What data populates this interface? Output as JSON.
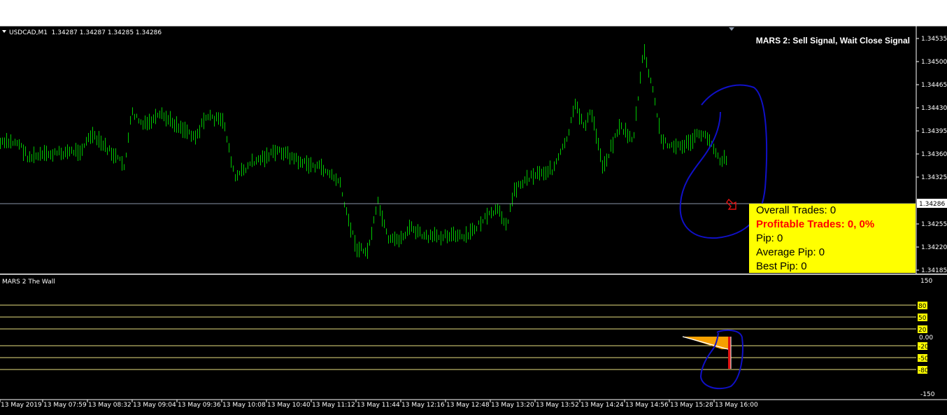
{
  "main": {
    "symbol_info": "USDCAD,M1  1.34287 1.34287 1.34285 1.34286",
    "signal": "MARS 2: Sell Signal, Wait Close Signal",
    "price_ticks": [
      "1.34535",
      "1.34500",
      "1.34465",
      "1.34430",
      "1.34395",
      "1.34360",
      "1.34325",
      "1.34255",
      "1.34220",
      "1.34185"
    ],
    "current_price": "1.34286",
    "price_range": [
      1.3417,
      1.3454
    ],
    "colors": {
      "candle": "#00c800",
      "background": "#000000",
      "annotation": "#1010c8",
      "stats_bg": "#ffff00",
      "label_bg": "#ffff00"
    }
  },
  "stats": {
    "overall": "Overall Trades: 0",
    "profitable": "Profitable Trades: 0, 0%",
    "pip": "Pip: 0",
    "average": "Average Pip: 0",
    "best": "Best Pip: 0"
  },
  "indicator": {
    "title": "MARS 2 The Wall",
    "top_tick": "150",
    "bottom_tick": "-150",
    "zero_tick": "0.00",
    "levels": [
      "80",
      "50",
      "20",
      "-20",
      "-50",
      "-80"
    ]
  },
  "time_axis": [
    "13 May 2019",
    "13 May 07:59",
    "13 May 08:32",
    "13 May 09:04",
    "13 May 09:36",
    "13 May 10:08",
    "13 May 10:40",
    "13 May 11:12",
    "13 May 11:44",
    "13 May 12:16",
    "13 May 12:48",
    "13 May 13:20",
    "13 May 13:52",
    "13 May 14:24",
    "13 May 14:56",
    "13 May 15:28",
    "13 May 16:00"
  ]
}
